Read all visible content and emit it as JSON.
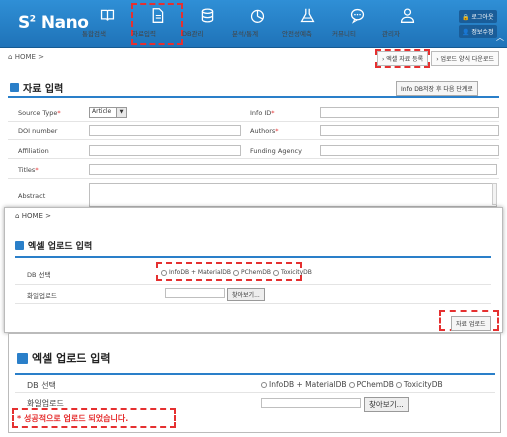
{
  "app": {
    "logo_main": "S",
    "logo_sup": "2",
    "logo_rest": " Nano"
  },
  "nav": {
    "items": [
      {
        "label": "통합검색",
        "icon": "book-icon"
      },
      {
        "label": "자료입력",
        "icon": "document-icon"
      },
      {
        "label": "DB관리",
        "icon": "database-icon"
      },
      {
        "label": "분석/통계",
        "icon": "piechart-icon"
      },
      {
        "label": "안전성예측",
        "icon": "flask-icon"
      },
      {
        "label": "커뮤니티",
        "icon": "chat-icon"
      },
      {
        "label": "관리자",
        "icon": "admin-icon"
      }
    ],
    "logout": "로그아웃",
    "myinfo": "정보수정"
  },
  "breadcrumb": "HOME >",
  "subtabs": {
    "excel_upload": "› 엑셀 자료 등록",
    "template_download": "› 업로드 양식 다운로드"
  },
  "form_section": {
    "title": "자료 입력",
    "next_button": "Info DB저장 후 다음 단계로",
    "source_type_label": "Source Type",
    "source_type_value": "Article",
    "info_id_label": "Info ID",
    "doi_label": "DOI number",
    "authors_label": "Authors",
    "affiliation_label": "Affiliation",
    "funding_label": "Funding Agency",
    "titles_label": "Titles",
    "abstract_label": "Abstract"
  },
  "excel_section": {
    "breadcrumb": "HOME >",
    "title": "엑셀 업로드 입력",
    "db_label": "DB 선택",
    "db_options": "InfoDB + MaterialDB  PChemDB  ToxicityDB",
    "opt1": "InfoDB + MaterialDB",
    "opt2": "PChemDB",
    "opt3": "ToxicityDB",
    "file_label": "화일업로드",
    "browse": "찾아보기...",
    "upload_button": "자료 업로드"
  },
  "result_section": {
    "title": "엑셀 업로드 입력",
    "db_label": "DB 선택",
    "opt1": "InfoDB + MaterialDB",
    "opt2": "PChemDB",
    "opt3": "ToxicityDB",
    "file_label": "화일업로드",
    "browse": "찾아보기...",
    "success_msg": "* 성공적으로 업로드 되었습니다."
  },
  "colors": {
    "nav_blue": "#1f73b8",
    "accent_blue": "#2a7fc9",
    "highlight_red": "#e53030"
  }
}
